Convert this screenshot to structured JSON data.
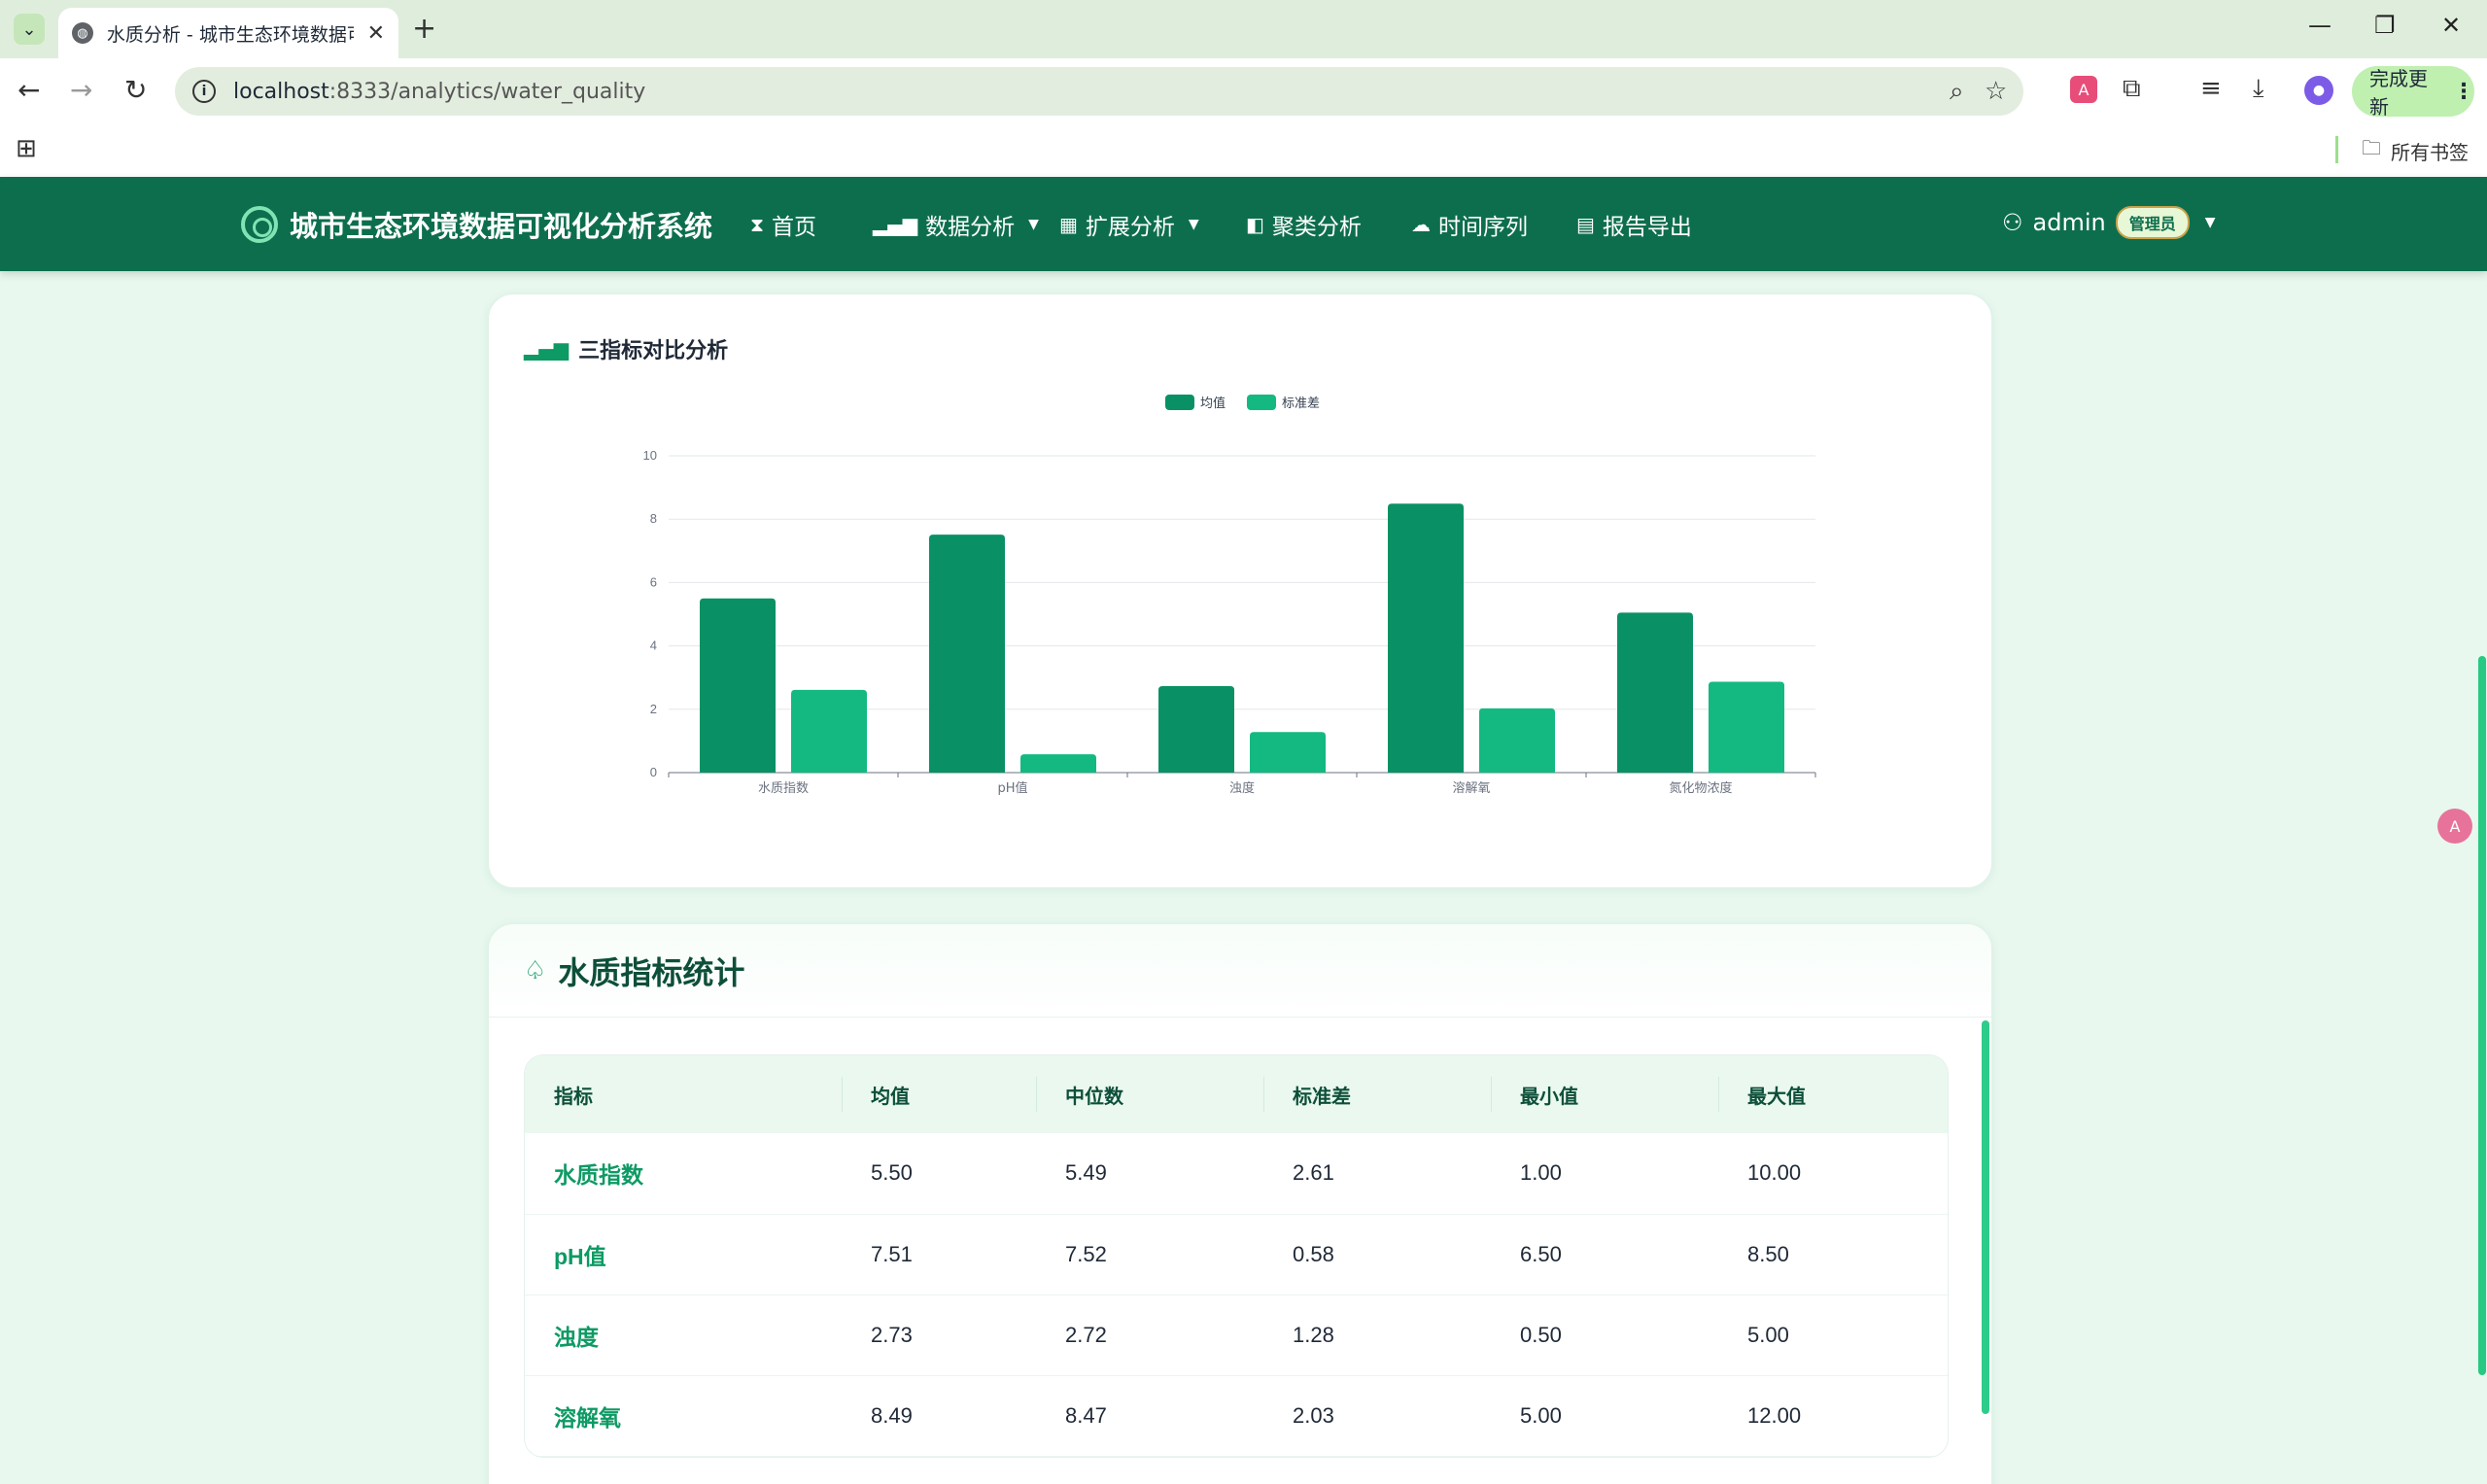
{
  "browser": {
    "tab_title": "水质分析 - 城市生态环境数据可",
    "url_host": "localhost",
    "url_rest": ":8333/analytics/water_quality",
    "update_label": "完成更新",
    "bookmarks_folder": "所有书签"
  },
  "nav": {
    "brand": "城市生态环境数据可视化分析系统",
    "items": [
      {
        "label": "首页",
        "icon": "hourglass-icon"
      },
      {
        "label": "数据分析",
        "icon": "bar-chart-icon",
        "dropdown": true
      },
      {
        "label": "扩展分析",
        "icon": "grid-icon",
        "dropdown": true
      },
      {
        "label": "聚类分析",
        "icon": "panel-icon"
      },
      {
        "label": "时间序列",
        "icon": "cloud-icon"
      },
      {
        "label": "报告导出",
        "icon": "document-icon"
      }
    ],
    "user": "admin",
    "role": "管理员"
  },
  "chart_card": {
    "title": "三指标对比分析"
  },
  "chart_data": {
    "type": "bar",
    "categories": [
      "水质指数",
      "pH值",
      "浊度",
      "溶解氧",
      "氮化物浓度"
    ],
    "series": [
      {
        "name": "均值",
        "values": [
          5.5,
          7.51,
          2.73,
          8.49,
          5.05
        ],
        "color": "#099165"
      },
      {
        "name": "标准差",
        "values": [
          2.61,
          0.58,
          1.28,
          2.03,
          2.87
        ],
        "color": "#14b981"
      }
    ],
    "ylim": [
      0,
      10
    ],
    "yticks": [
      0,
      2,
      4,
      6,
      8,
      10
    ],
    "legend": "top-center",
    "grid": true
  },
  "stats": {
    "title": "水质指标统计",
    "columns": [
      "指标",
      "均值",
      "中位数",
      "标准差",
      "最小值",
      "最大值"
    ],
    "rows": [
      [
        "水质指数",
        "5.50",
        "5.49",
        "2.61",
        "1.00",
        "10.00"
      ],
      [
        "pH值",
        "7.51",
        "7.52",
        "0.58",
        "6.50",
        "8.50"
      ],
      [
        "浊度",
        "2.73",
        "2.72",
        "1.28",
        "0.50",
        "5.00"
      ],
      [
        "溶解氧",
        "8.49",
        "8.47",
        "2.03",
        "5.00",
        "12.00"
      ]
    ]
  }
}
